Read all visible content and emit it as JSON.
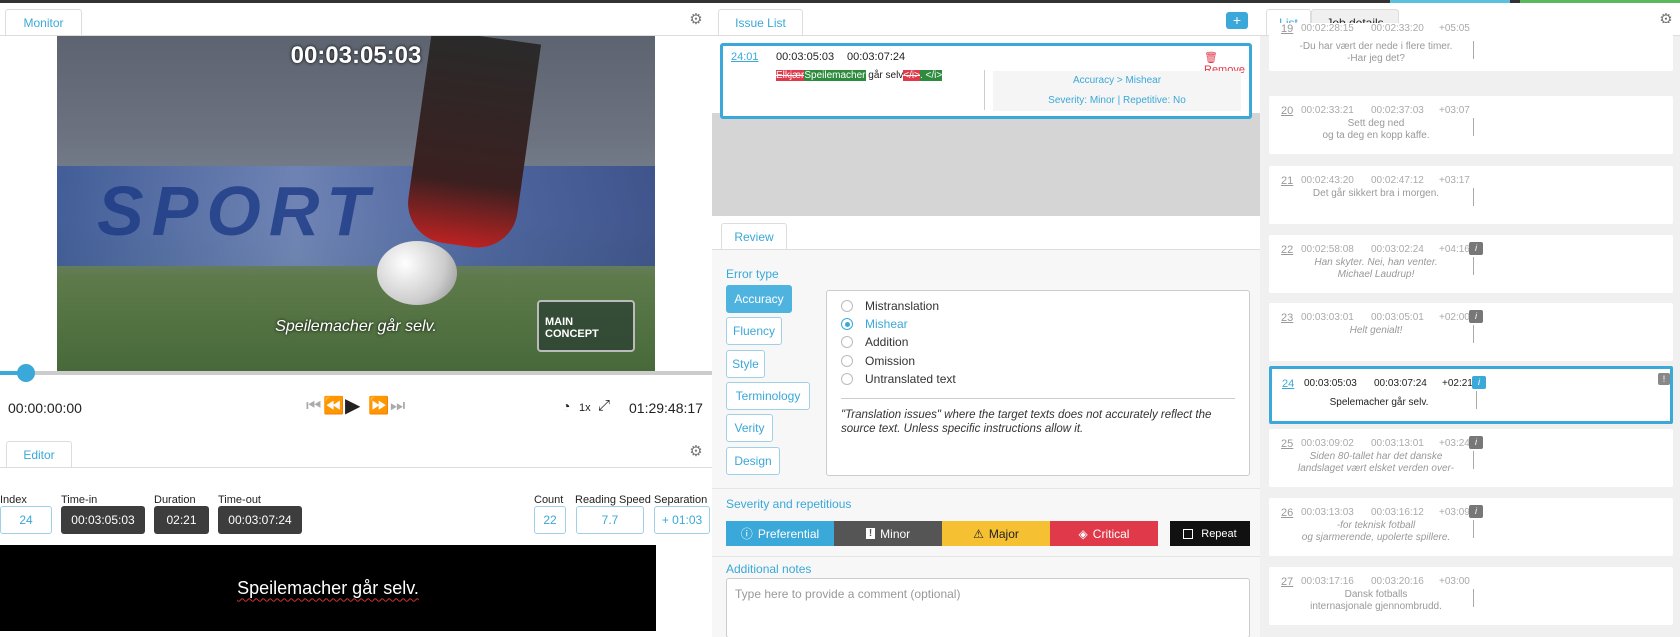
{
  "monitor": {
    "tab": "Monitor",
    "video_timecode": "00:03:05:03",
    "video_subtitle": "Speilemacher går selv.",
    "logo_text": "MAIN CONCEPT",
    "time_current": "00:00:00:00",
    "speed": "1x",
    "time_total": "01:29:48:17"
  },
  "editor": {
    "tab": "Editor",
    "labels": {
      "index": "Index",
      "time_in": "Time-in",
      "duration": "Duration",
      "time_out": "Time-out",
      "count": "Count",
      "reading_speed": "Reading Speed",
      "separation": "Separation"
    },
    "values": {
      "index": "24",
      "time_in": "00:03:05:03",
      "duration": "02:21",
      "time_out": "00:03:07:24",
      "count": "22",
      "reading_speed": "7.7",
      "separation": "+ 01:03"
    },
    "text": "Speilemacher går selv."
  },
  "issues": {
    "tab": "Issue List",
    "add_label": "+",
    "item": {
      "ref": "24:01",
      "time_in": "00:03:05:03",
      "time_out": "00:03:07:24",
      "remove_label": "Remove",
      "diff_removed": "Elkjær",
      "diff_added": "Speilemacher",
      "diff_plain": " går selv",
      "diff_removed_tag": "</i>",
      "diff_added_tag": ". </i>",
      "category": "Accuracy > Mishear",
      "severity": "Severity: Minor | Repetitive: No"
    }
  },
  "review": {
    "tab": "Review",
    "error_type_label": "Error type",
    "error_types": [
      "Accuracy",
      "Fluency",
      "Style",
      "Terminology",
      "Verity",
      "Design"
    ],
    "options": [
      "Mistranslation",
      "Mishear",
      "Addition",
      "Omission",
      "Untranslated text"
    ],
    "selected_option": "Mishear",
    "description": "\"Translation issues\" where the target texts does not accurately reflect the source text. Unless specific instructions allow it.",
    "severity_label": "Severity and repetitious",
    "severities": [
      "Preferential",
      "Minor",
      "Major",
      "Critical"
    ],
    "repeat_label": "Repeat",
    "notes_label": "Additional notes",
    "notes_placeholder": "Type here to provide a comment (optional)",
    "colors": {
      "preferential": "#3aa8d8",
      "minor": "#555555",
      "major": "#f5c032",
      "critical": "#e0394a"
    }
  },
  "list": {
    "tabs": [
      "List",
      "Job details"
    ],
    "rows": [
      {
        "num": "19",
        "in": "00:02:28:15",
        "out": "00:02:33:20",
        "dur": "+05:05",
        "text": "-Du har vært der nede i flere timer.\n-Har jeg det?",
        "italic": false,
        "badge": false
      },
      {
        "num": "20",
        "in": "00:02:33:21",
        "out": "00:02:37:03",
        "dur": "+03:07",
        "text": "Sett deg ned\nog ta deg en kopp kaffe.",
        "italic": false,
        "badge": false
      },
      {
        "num": "21",
        "in": "00:02:43:20",
        "out": "00:02:47:12",
        "dur": "+03:17",
        "text": "Det går sikkert bra i morgen.",
        "italic": false,
        "badge": false
      },
      {
        "num": "22",
        "in": "00:02:58:08",
        "out": "00:03:02:24",
        "dur": "+04:16",
        "text": "Han skyter. Nei, han venter.\nMichael Laudrup!",
        "italic": true,
        "badge": true
      },
      {
        "num": "23",
        "in": "00:03:03:01",
        "out": "00:03:05:01",
        "dur": "+02:00",
        "text": "Helt genialt!",
        "italic": true,
        "badge": true
      },
      {
        "num": "24",
        "in": "00:03:05:03",
        "out": "00:03:07:24",
        "dur": "+02:21",
        "text": "Spelemacher går selv.",
        "italic": false,
        "badge": true
      },
      {
        "num": "25",
        "in": "00:03:09:02",
        "out": "00:03:13:01",
        "dur": "+03:24",
        "text": "Siden 80-tallet har det danske\nlandslaget vært elsket verden over-",
        "italic": true,
        "badge": true
      },
      {
        "num": "26",
        "in": "00:03:13:03",
        "out": "00:03:16:12",
        "dur": "+03:09",
        "text": "-for teknisk fotball\nog sjarmerende, upolerte spillere.",
        "italic": true,
        "badge": true
      },
      {
        "num": "27",
        "in": "00:03:17:16",
        "out": "00:03:20:16",
        "dur": "+03:00",
        "text": "Dansk fotballs\ninternasjonale gjennombrudd.",
        "italic": false,
        "badge": false
      }
    ],
    "badge_label": "i",
    "flag_label": "!"
  }
}
